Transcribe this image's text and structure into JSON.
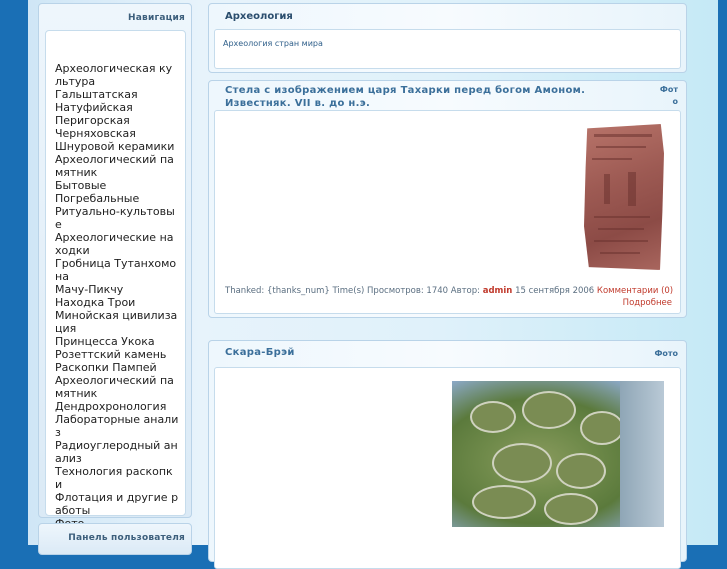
{
  "sidebar": {
    "navigation": {
      "title": "Навигация",
      "items": [
        {
          "label": "Археологическая культура"
        },
        {
          "label": "Гальштатская"
        },
        {
          "label": "Натуфийская"
        },
        {
          "label": "Перигорская"
        },
        {
          "label": "Черняховская"
        },
        {
          "label": "Шнуровой керамики"
        },
        {
          "label": "Археологический памятник"
        },
        {
          "label": "Бытовые"
        },
        {
          "label": "Погребальные"
        },
        {
          "label": "Ритуально-культовые"
        },
        {
          "label": "Археологические находки"
        },
        {
          "label": "Гробница Тутанхомона"
        },
        {
          "label": "Мачу-Пикчу"
        },
        {
          "label": "Находка Трои"
        },
        {
          "label": "Минойская цивилизация"
        },
        {
          "label": "Принцесса Укока"
        },
        {
          "label": "Розеттский камень"
        },
        {
          "label": "Раскопки Пампей"
        },
        {
          "label": "Археологический памятник"
        },
        {
          "label": "Дендрохронология"
        },
        {
          "label": "Лабораторные анализ"
        },
        {
          "label": "Радиоуглеродный анализ"
        },
        {
          "label": "Технология раскопки"
        },
        {
          "label": "Флотация и другие работы"
        },
        {
          "label": "Фото"
        }
      ]
    },
    "user_panel": {
      "title": "Панель пользователя"
    }
  },
  "category": {
    "title": "Археология",
    "link": "Археология стран мира"
  },
  "articles": [
    {
      "title": "Стела с изображением царя Тахарки перед богом Амоном. Известняк. VII в. до н.э.",
      "tag_line1": "Фот",
      "tag_line2": "о",
      "meta_prefix": "Thanked: {thanks_num} Time(s) Просмотров: 1740 Автор:",
      "author": "admin",
      "date": "15 сентября 2006",
      "comments": "Комментарии (0)",
      "more": "Подробнее",
      "image": "stela-photo"
    },
    {
      "title": "Скара-Брэй",
      "tag": "Фото",
      "image": "skara-brae-photo"
    }
  ]
}
